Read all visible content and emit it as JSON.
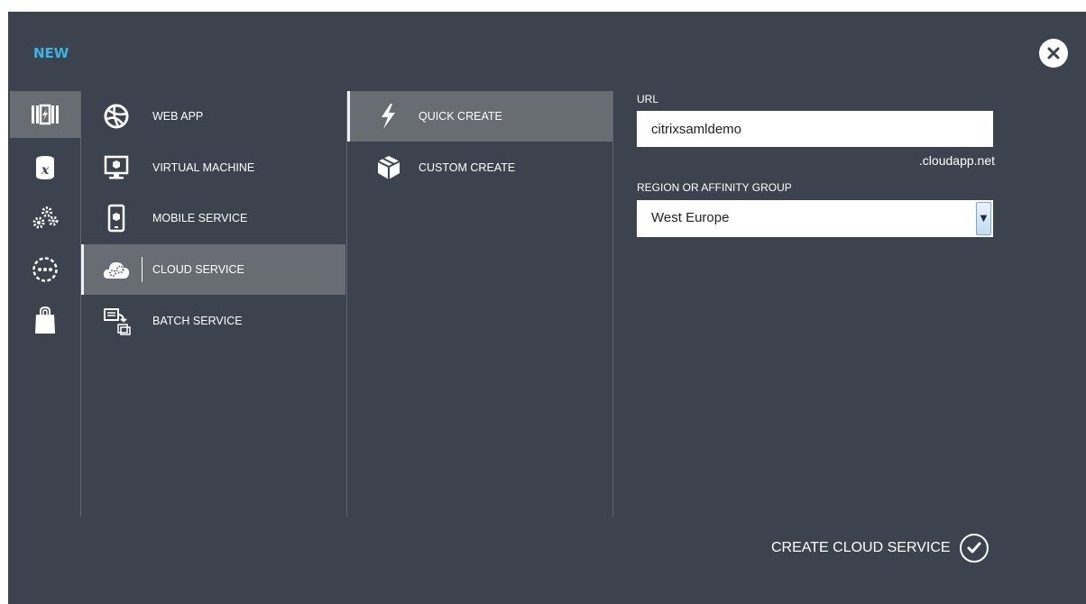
{
  "dialog": {
    "title": "NEW",
    "close_icon": "close-icon",
    "accent_color": "#39b4e4",
    "background_color": "#3d434e",
    "selected_color": "#686d74"
  },
  "categories": [
    {
      "icon": "compute-icon",
      "active": true
    },
    {
      "icon": "data-services-icon",
      "active": false
    },
    {
      "icon": "app-services-icon",
      "active": false
    },
    {
      "icon": "network-services-icon",
      "active": false
    },
    {
      "icon": "store-icon",
      "active": false
    }
  ],
  "services": [
    {
      "label": "WEB APP",
      "icon": "web-app-icon",
      "active": false
    },
    {
      "label": "VIRTUAL MACHINE",
      "icon": "virtual-machine-icon",
      "active": false
    },
    {
      "label": "MOBILE SERVICE",
      "icon": "mobile-service-icon",
      "active": false
    },
    {
      "label": "CLOUD SERVICE",
      "icon": "cloud-service-icon",
      "active": true
    },
    {
      "label": "BATCH SERVICE",
      "icon": "batch-service-icon",
      "active": false
    }
  ],
  "create_options": [
    {
      "label": "QUICK CREATE",
      "icon": "lightning-icon",
      "active": true
    },
    {
      "label": "CUSTOM CREATE",
      "icon": "package-icon",
      "active": false
    }
  ],
  "form": {
    "url_label": "URL",
    "url_value": "citrixsamldemo",
    "url_suffix": ".cloudapp.net",
    "region_label": "REGION OR AFFINITY GROUP",
    "region_value": "West Europe"
  },
  "footer": {
    "create_label": "CREATE CLOUD SERVICE",
    "create_icon": "checkmark-icon"
  }
}
